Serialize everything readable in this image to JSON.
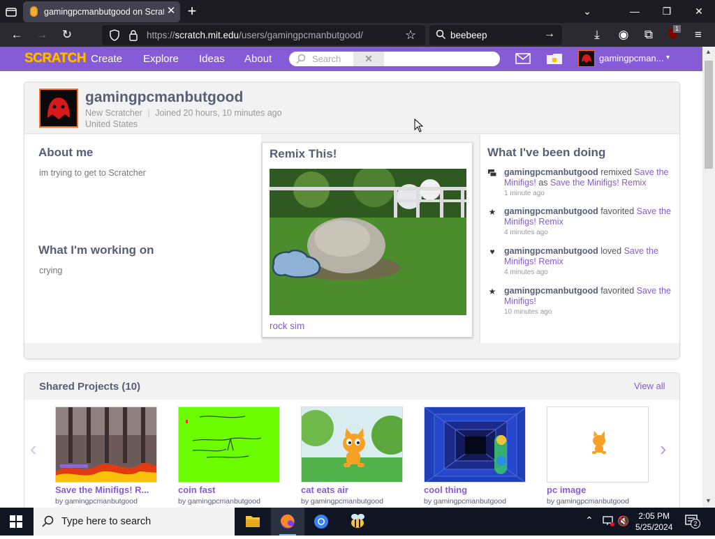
{
  "browser": {
    "tab_title": "gamingpcmanbutgood on Scratch",
    "url_host_prefix": "https://",
    "url_host": "scratch.mit.edu",
    "url_path": "/users/gamingpcmanbutgood/",
    "search_query": "beebeep",
    "extension_badge": "1"
  },
  "scratch_nav": {
    "logo": "SCRATCH",
    "links": [
      "Create",
      "Explore",
      "Ideas",
      "About"
    ],
    "search_placeholder": "Search",
    "username": "gamingpcman..."
  },
  "profile": {
    "username": "gamingpcmanbutgood",
    "rank": "New Scratcher",
    "joined": "Joined 20 hours, 10 minutes ago",
    "location": "United States",
    "about_title": "About me",
    "about_text": "im trying to get to Scratcher",
    "working_title": "What I'm working on",
    "working_text": "crying",
    "featured_title": "Remix This!",
    "featured_project": "rock sim",
    "activity_title": "What I've been doing",
    "activity": [
      {
        "icon": "remix-icon",
        "user": "gamingpcmanbutgood",
        "verb": "remixed",
        "target": "Save the Minifigs!",
        "mid": "as",
        "target2": "Save the Minifigs! Remix",
        "time": "1 minute ago"
      },
      {
        "icon": "star-icon",
        "user": "gamingpcmanbutgood",
        "verb": "favorited",
        "target": "Save the Minifigs! Remix",
        "time": "4 minutes ago"
      },
      {
        "icon": "heart-icon",
        "user": "gamingpcmanbutgood",
        "verb": "loved",
        "target": "Save the Minifigs! Remix",
        "time": "4 minutes ago"
      },
      {
        "icon": "star-icon",
        "user": "gamingpcmanbutgood",
        "verb": "favorited",
        "target": "Save the Minifigs!",
        "time": "10 minutes ago"
      }
    ]
  },
  "shared_projects": {
    "title": "Shared Projects (10)",
    "view_all": "View all",
    "projects": [
      {
        "title": "Save the Minifigs! R...",
        "by": "by gamingpcmanbutgood"
      },
      {
        "title": "coin fast",
        "by": "by gamingpcmanbutgood"
      },
      {
        "title": "cat eats air",
        "by": "by gamingpcmanbutgood"
      },
      {
        "title": "cool thing",
        "by": "by gamingpcmanbutgood"
      },
      {
        "title": "pc image",
        "by": "by gamingpcmanbutgood"
      }
    ]
  },
  "taskbar": {
    "search_placeholder": "Type here to search",
    "time": "2:05 PM",
    "date": "5/25/2024",
    "notifications": "2"
  }
}
